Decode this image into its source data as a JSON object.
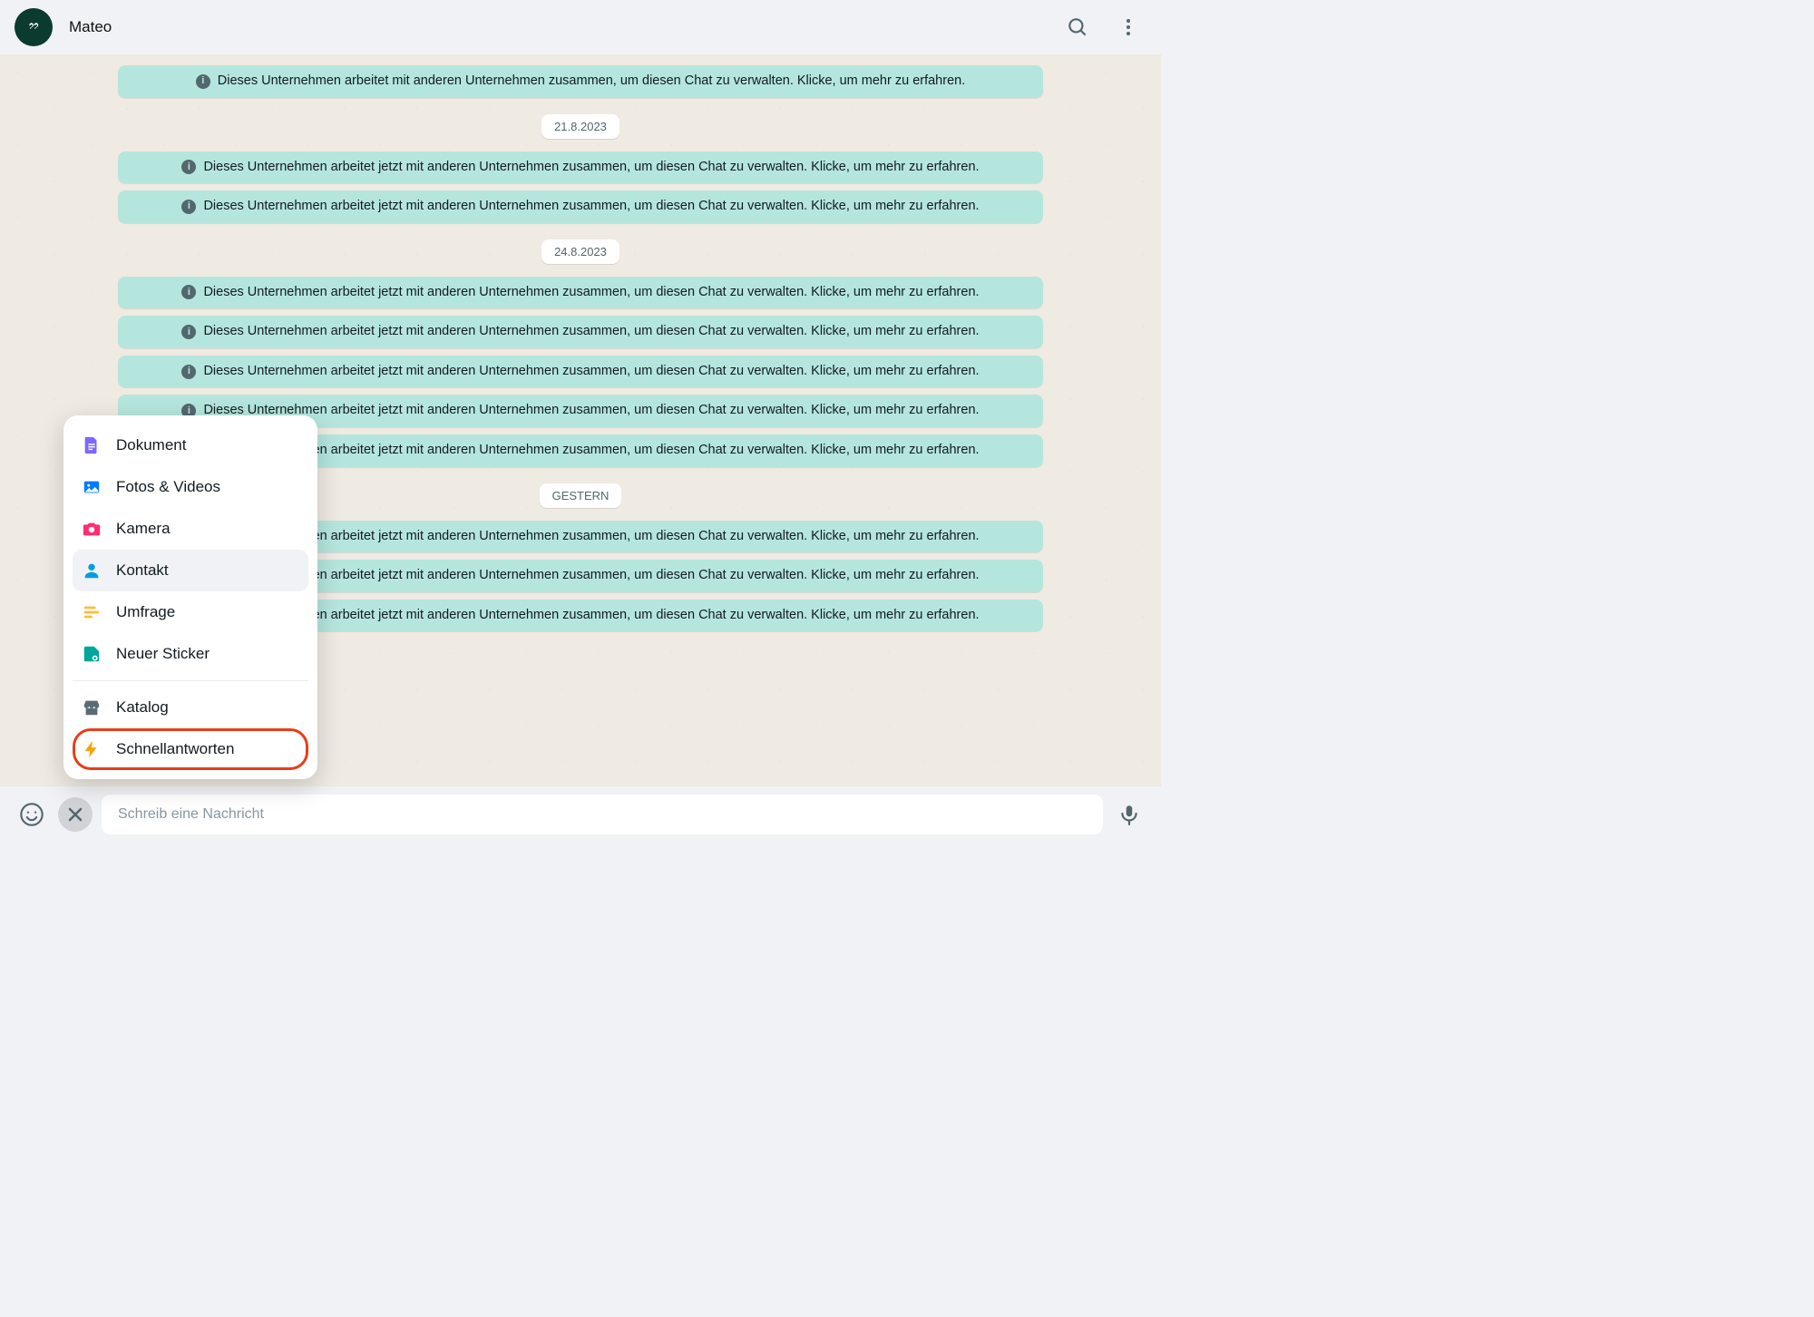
{
  "header": {
    "avatar_glyph": "⁠⁠‘‘",
    "chat_name": "Mateo"
  },
  "system_notices": {
    "managed_present": "Dieses Unternehmen arbeitet mit anderen Unternehmen zusammen, um diesen Chat zu verwalten. Klicke, um mehr zu erfahren.",
    "managed_now": "Dieses Unternehmen arbeitet jetzt mit anderen Unternehmen zusammen, um diesen Chat zu verwalten. Klicke, um mehr zu erfahren."
  },
  "timeline": [
    {
      "type": "system",
      "key": "managed_present"
    },
    {
      "type": "date",
      "label": "21.8.2023"
    },
    {
      "type": "system",
      "key": "managed_now"
    },
    {
      "type": "system",
      "key": "managed_now"
    },
    {
      "type": "date",
      "label": "24.8.2023"
    },
    {
      "type": "system",
      "key": "managed_now"
    },
    {
      "type": "system",
      "key": "managed_now"
    },
    {
      "type": "system",
      "key": "managed_now"
    },
    {
      "type": "system",
      "key": "managed_now"
    },
    {
      "type": "system",
      "key": "managed_now"
    },
    {
      "type": "date",
      "label": "GESTERN"
    },
    {
      "type": "system",
      "key": "managed_now"
    },
    {
      "type": "system",
      "key": "managed_now"
    },
    {
      "type": "system",
      "key": "managed_now"
    }
  ],
  "composer": {
    "placeholder": "Schreib eine Nachricht"
  },
  "attach_menu": {
    "items": [
      {
        "icon": "document",
        "label": "Dokument",
        "color": "#7f66ff"
      },
      {
        "icon": "media",
        "label": "Fotos & Videos",
        "color": "#007bfc"
      },
      {
        "icon": "camera",
        "label": "Kamera",
        "color": "#ff2e74"
      },
      {
        "icon": "contact",
        "label": "Kontakt",
        "color": "#009de2",
        "hovered": true
      },
      {
        "icon": "poll",
        "label": "Umfrage",
        "color": "#ffbc38"
      },
      {
        "icon": "sticker",
        "label": "Neuer Sticker",
        "color": "#02a698"
      },
      {
        "divider": true
      },
      {
        "icon": "catalog",
        "label": "Katalog",
        "color": "#5b6b76"
      },
      {
        "icon": "quick",
        "label": "Schnellantworten",
        "color": "#ffa000",
        "highlighted": true
      }
    ]
  }
}
